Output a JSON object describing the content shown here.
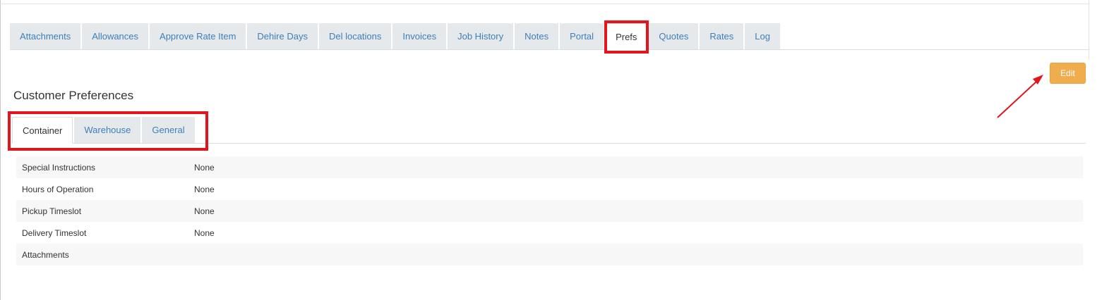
{
  "main_tabs": [
    {
      "label": "Attachments"
    },
    {
      "label": "Allowances"
    },
    {
      "label": "Approve Rate Item"
    },
    {
      "label": "Dehire Days"
    },
    {
      "label": "Del locations"
    },
    {
      "label": "Invoices"
    },
    {
      "label": "Job History"
    },
    {
      "label": "Notes"
    },
    {
      "label": "Portal"
    },
    {
      "label": "Prefs",
      "active": true
    },
    {
      "label": "Quotes"
    },
    {
      "label": "Rates"
    },
    {
      "label": "Log"
    }
  ],
  "edit_button": {
    "label": "Edit",
    "color": "#f0ad4e"
  },
  "section": {
    "title": "Customer Preferences"
  },
  "sub_tabs": [
    {
      "label": "Container",
      "active": true
    },
    {
      "label": "Warehouse"
    },
    {
      "label": "General"
    }
  ],
  "details": {
    "rows": [
      {
        "label": "Special Instructions",
        "value": "None"
      },
      {
        "label": "Hours of Operation",
        "value": "None"
      },
      {
        "label": "Pickup Timeslot",
        "value": "None"
      },
      {
        "label": "Delivery Timeslot",
        "value": "None"
      },
      {
        "label": "Attachments",
        "value": ""
      }
    ]
  },
  "colors": {
    "link": "#3d7fba",
    "tab_bg": "#e6e9ec",
    "annotation": "#e3141b"
  }
}
